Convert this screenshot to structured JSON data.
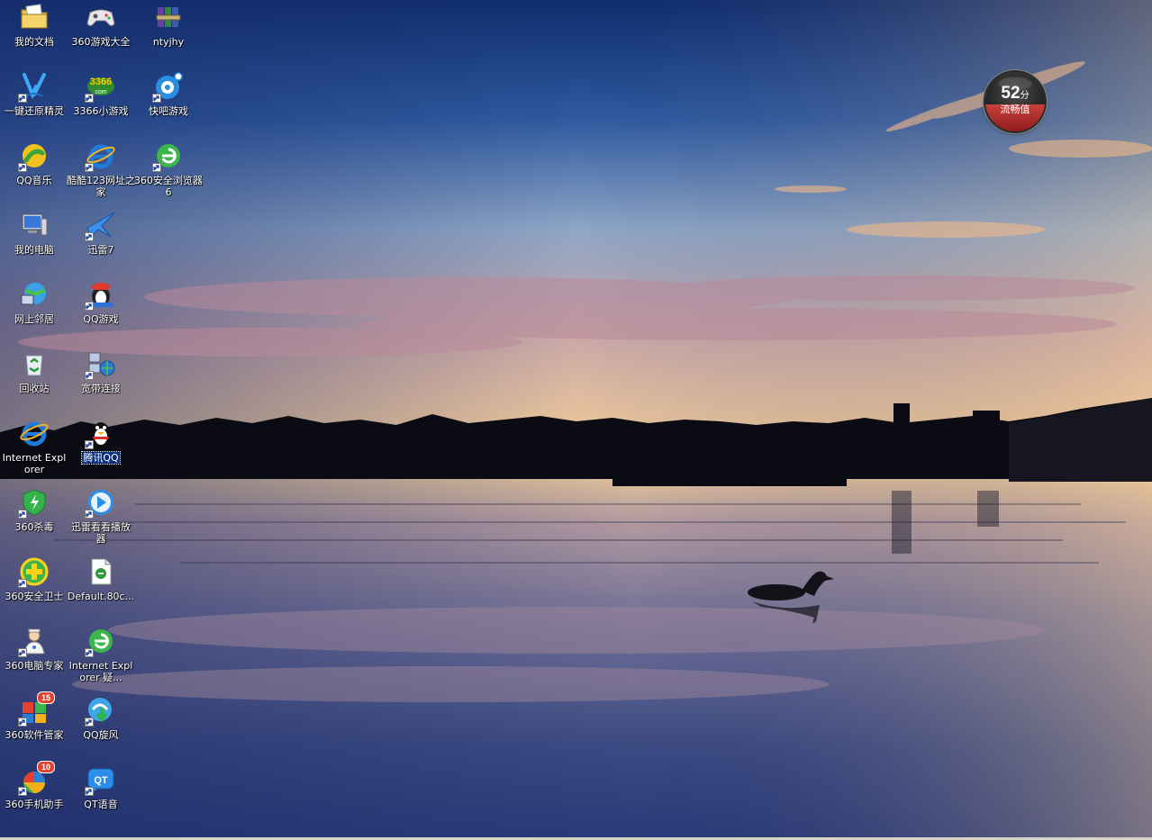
{
  "desktop": {
    "icons": [
      {
        "id": "my-documents",
        "label": "我的文档",
        "icon": "folder-documents-icon",
        "shortcut": false
      },
      {
        "id": "360-games",
        "label": "360游戏大全",
        "icon": "gamepad-icon",
        "shortcut": false
      },
      {
        "id": "ntyjhy",
        "label": "ntyjhy",
        "icon": "archive-books-icon",
        "shortcut": false
      },
      {
        "id": "one-key-restore",
        "label": "一键还原精灵",
        "icon": "restore-wizard-icon",
        "shortcut": true
      },
      {
        "id": "3366-games",
        "label": "3366小游戏",
        "icon": "3366-logo-icon",
        "shortcut": true
      },
      {
        "id": "kuaiba-games",
        "label": "快吧游戏",
        "icon": "kuaiba-disc-icon",
        "shortcut": true
      },
      {
        "id": "qq-music",
        "label": "QQ音乐",
        "icon": "qq-music-icon",
        "shortcut": true
      },
      {
        "id": "kuku123",
        "label": "酷酷123网址之家",
        "icon": "ie-logo-icon",
        "shortcut": true
      },
      {
        "id": "360-browser",
        "label": "360安全浏览器6",
        "icon": "360-browser-icon",
        "shortcut": true
      },
      {
        "id": "my-computer",
        "label": "我的电脑",
        "icon": "computer-icon",
        "shortcut": false
      },
      {
        "id": "xunlei7",
        "label": "迅雷7",
        "icon": "xunlei-bird-icon",
        "shortcut": true
      },
      {
        "id": "network-places",
        "label": "网上邻居",
        "icon": "network-icon",
        "shortcut": false
      },
      {
        "id": "qq-games",
        "label": "QQ游戏",
        "icon": "qq-games-icon",
        "shortcut": true
      },
      {
        "id": "recycle-bin",
        "label": "回收站",
        "icon": "recycle-bin-icon",
        "shortcut": false
      },
      {
        "id": "broadband",
        "label": "宽带连接",
        "icon": "broadband-connection-icon",
        "shortcut": true
      },
      {
        "id": "internet-explorer",
        "label": "Internet Explorer",
        "icon": "ie-logo-icon",
        "shortcut": false
      },
      {
        "id": "tencent-qq",
        "label": "腾讯QQ",
        "icon": "qq-penguin-icon",
        "shortcut": true,
        "selected": true
      },
      {
        "id": "360-antivirus",
        "label": "360杀毒",
        "icon": "360-shield-icon",
        "shortcut": true
      },
      {
        "id": "xunlei-player",
        "label": "迅雷看看播放器",
        "icon": "xunlei-player-icon",
        "shortcut": true
      },
      {
        "id": "360-safeguard",
        "label": "360安全卫士",
        "icon": "360-safeguard-icon",
        "shortcut": true
      },
      {
        "id": "default-80c",
        "label": "Default.80c...",
        "icon": "document-file-icon",
        "shortcut": false
      },
      {
        "id": "360-pc-expert",
        "label": "360电脑专家",
        "icon": "pc-expert-doctor-icon",
        "shortcut": true
      },
      {
        "id": "ie-doctor",
        "label": "Internet Explorer 疑...",
        "icon": "360-browser-icon",
        "shortcut": true
      },
      {
        "id": "360-software",
        "label": "360软件管家",
        "icon": "360-software-icon",
        "shortcut": true,
        "badge": "15"
      },
      {
        "id": "qq-whirlwind",
        "label": "QQ旋风",
        "icon": "qq-whirlwind-icon",
        "shortcut": true
      },
      {
        "id": "360-phone",
        "label": "360手机助手",
        "icon": "360-phone-icon",
        "shortcut": true,
        "badge": "10"
      },
      {
        "id": "qt-voice",
        "label": "QT语音",
        "icon": "qt-voice-icon",
        "shortcut": true
      }
    ]
  },
  "speed_widget": {
    "score": "52",
    "unit": "分",
    "caption": "流畅值"
  },
  "colors": {
    "sky_top": "#1e3a78",
    "sky_horizon": "#f0cfa0",
    "water": "#3e4d7e",
    "widget_red": "#b83232"
  }
}
